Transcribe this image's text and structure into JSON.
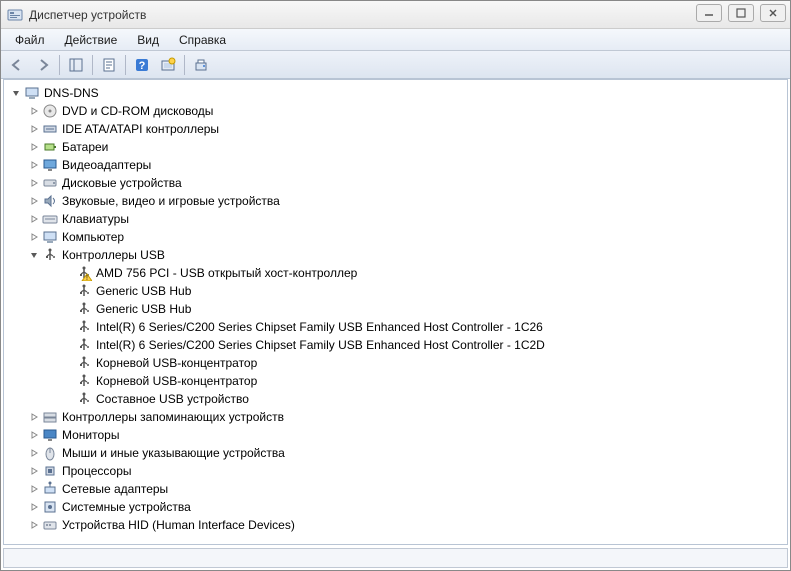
{
  "window": {
    "title": "Диспетчер устройств"
  },
  "menu": {
    "file": "Файл",
    "action": "Действие",
    "view": "Вид",
    "help": "Справка"
  },
  "tree": {
    "root": "DNS-DNS",
    "categories": [
      {
        "label": "DVD и CD-ROM дисководы",
        "icon": "disc"
      },
      {
        "label": "IDE ATA/ATAPI контроллеры",
        "icon": "ide"
      },
      {
        "label": "Батареи",
        "icon": "battery"
      },
      {
        "label": "Видеоадаптеры",
        "icon": "display"
      },
      {
        "label": "Дисковые устройства",
        "icon": "drive"
      },
      {
        "label": "Звуковые, видео и игровые устройства",
        "icon": "sound"
      },
      {
        "label": "Клавиатуры",
        "icon": "keyboard"
      },
      {
        "label": "Компьютер",
        "icon": "computer"
      },
      {
        "label": "Контроллеры USB",
        "icon": "usb",
        "expanded": true,
        "children": [
          {
            "label": "AMD 756 PCI - USB открытый хост-контроллер",
            "warn": true
          },
          {
            "label": "Generic USB Hub"
          },
          {
            "label": "Generic USB Hub"
          },
          {
            "label": "Intel(R) 6 Series/C200 Series Chipset Family USB Enhanced Host Controller - 1C26"
          },
          {
            "label": "Intel(R) 6 Series/C200 Series Chipset Family USB Enhanced Host Controller - 1C2D"
          },
          {
            "label": "Корневой USB-концентратор"
          },
          {
            "label": "Корневой USB-концентратор"
          },
          {
            "label": "Составное USB устройство"
          }
        ]
      },
      {
        "label": "Контроллеры запоминающих устройств",
        "icon": "storage"
      },
      {
        "label": "Мониторы",
        "icon": "monitor"
      },
      {
        "label": "Мыши и иные указывающие устройства",
        "icon": "mouse"
      },
      {
        "label": "Процессоры",
        "icon": "cpu"
      },
      {
        "label": "Сетевые адаптеры",
        "icon": "network"
      },
      {
        "label": "Системные устройства",
        "icon": "system"
      },
      {
        "label": "Устройства HID (Human Interface Devices)",
        "icon": "hid"
      }
    ]
  }
}
